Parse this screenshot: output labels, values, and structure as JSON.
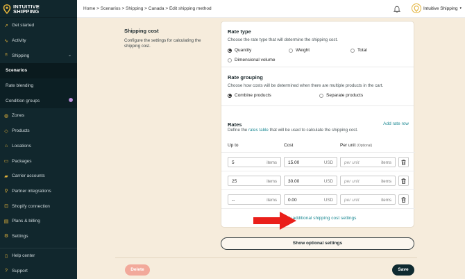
{
  "brand": {
    "line1": "INTUITIVE",
    "line2": "SHIPPING",
    "accent": "#e3b33b"
  },
  "sidebar": {
    "items": [
      {
        "label": "Get started",
        "icon": "rocket-icon"
      },
      {
        "label": "Activity",
        "icon": "activity-icon"
      },
      {
        "label": "Shipping",
        "icon": "pin-icon"
      },
      {
        "label": "Scenarios"
      },
      {
        "label": "Rate blending"
      },
      {
        "label": "Condition groups",
        "badge": "!"
      },
      {
        "label": "Zones",
        "icon": "globe-icon"
      },
      {
        "label": "Products",
        "icon": "tag-icon"
      },
      {
        "label": "Locations",
        "icon": "location-icon"
      },
      {
        "label": "Packages",
        "icon": "box-icon"
      },
      {
        "label": "Carrier accounts",
        "icon": "truck-icon"
      },
      {
        "label": "Partner integrations",
        "icon": "plug-icon"
      },
      {
        "label": "Shopify connection",
        "icon": "shop-icon"
      },
      {
        "label": "Plans & billing",
        "icon": "card-icon"
      },
      {
        "label": "Settings",
        "icon": "gear-icon"
      }
    ],
    "bottom": [
      {
        "label": "Help center",
        "icon": "book-icon"
      },
      {
        "label": "Support",
        "icon": "help-icon"
      }
    ]
  },
  "header": {
    "breadcrumb": "Home > Scenarios > Shipping > Canada > Edit shipping method",
    "account": "Intuitive Shipping"
  },
  "shipping_cost": {
    "title": "Shipping cost",
    "description": "Configure the settings for calculating the shipping cost."
  },
  "rate_type": {
    "title": "Rate type",
    "description": "Choose the rate type that will determine the shipping cost.",
    "options": [
      "Quantity",
      "Weight",
      "Total",
      "Dimensional volume"
    ],
    "selected": "Quantity"
  },
  "rate_grouping": {
    "title": "Rate grouping",
    "description": "Choose how costs will be determined when there are multiple products in the cart.",
    "options": [
      "Combine products",
      "Separate products"
    ],
    "selected": "Combine products"
  },
  "rates": {
    "title": "Rates",
    "desc_pre": "Define the ",
    "desc_link": "rates table",
    "desc_post": " that will be used to calculate the shipping cost.",
    "add_row": "Add rate row",
    "columns": {
      "up_to": "Up to",
      "cost": "Cost",
      "per_unit": "Per unit",
      "optional": "(Optional)"
    },
    "rows": [
      {
        "up_to": "5",
        "up_to_unit": "items",
        "cost": "15.00",
        "currency": "USD",
        "per_unit_placeholder": "per unit",
        "per_unit_unit": "items"
      },
      {
        "up_to": "25",
        "up_to_unit": "items",
        "cost": "30.00",
        "currency": "USD",
        "per_unit_placeholder": "per unit",
        "per_unit_unit": "items"
      },
      {
        "up_to": "--",
        "up_to_unit": "items",
        "cost": "0.00",
        "currency": "USD",
        "per_unit_placeholder": "per unit",
        "per_unit_unit": "items"
      }
    ],
    "show_additional": "Show additional shipping cost settings"
  },
  "buttons": {
    "optional": "Show optional settings",
    "delete": "Delete",
    "save": "Save"
  }
}
